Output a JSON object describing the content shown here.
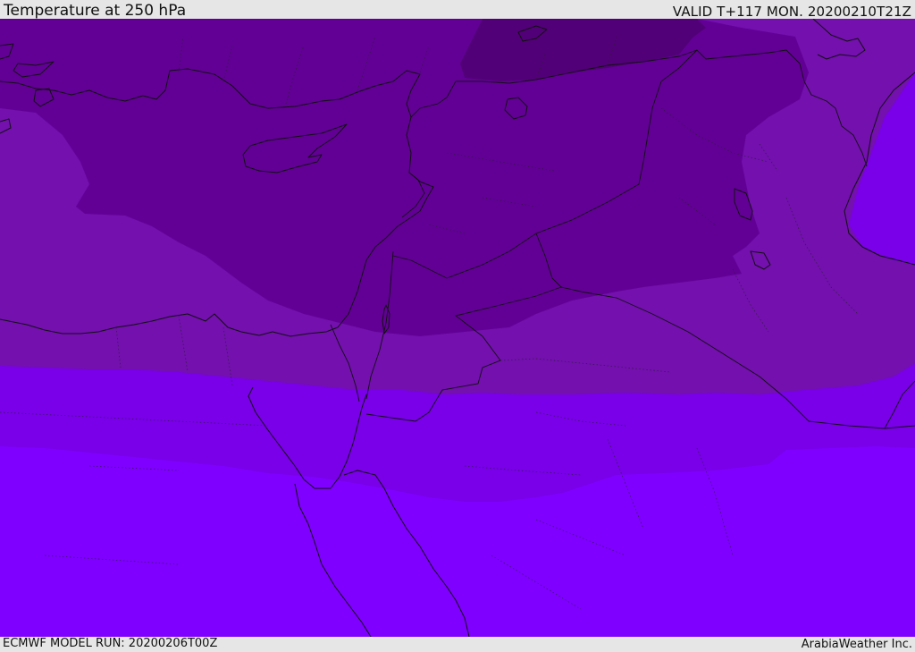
{
  "header": {
    "title": "Temperature at 250 hPa",
    "valid": "VALID T+117 MON. 20200210T21Z"
  },
  "footer": {
    "model_run": "ECMWF MODEL RUN: 20200206T00Z",
    "credit": "ArabiaWeather Inc."
  },
  "map": {
    "field": "temperature-250hPa",
    "colors": {
      "darkest": "#520078",
      "dark": "#620096",
      "medium": "#7310ae",
      "bright": "#7900e8",
      "brightest": "#7f00ff"
    }
  }
}
